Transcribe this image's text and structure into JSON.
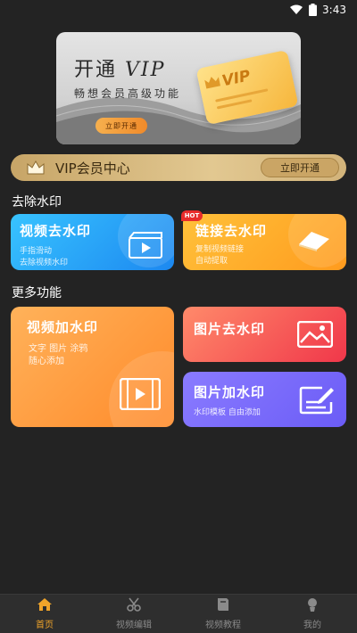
{
  "status_bar": {
    "time": "3:43"
  },
  "banner": {
    "title_cn": "开通",
    "title_en": "VIP",
    "subtitle": "畅想会员高级功能",
    "button": "立即开通",
    "card_label": "VIP"
  },
  "vip_center": {
    "label": "VIP会员中心",
    "button": "立即开通"
  },
  "sections": {
    "remove_watermark": "去除水印",
    "more_functions": "更多功能"
  },
  "cards": {
    "video_remove": {
      "title": "视频去水印",
      "line1": "手指滑动",
      "line2": "去除视频水印"
    },
    "link_remove": {
      "title": "链接去水印",
      "badge": "HOT",
      "line1": "复制视频链接",
      "line2": "自动提取"
    },
    "video_add": {
      "title": "视频加水印",
      "line1": "文字 图片 涂鸦",
      "line2": "随心添加"
    },
    "image_remove": {
      "title": "图片去水印"
    },
    "image_add": {
      "title": "图片加水印",
      "line1": "水印模板  自由添加"
    }
  },
  "nav": [
    {
      "label": "首页",
      "icon": "home-icon",
      "active": true
    },
    {
      "label": "视频编辑",
      "icon": "scissors-icon",
      "active": false
    },
    {
      "label": "视频教程",
      "icon": "book-icon",
      "active": false
    },
    {
      "label": "我的",
      "icon": "user-icon",
      "active": false
    }
  ],
  "colors": {
    "accent": "#f0a42a",
    "background": "#232323",
    "vip_gold": "#d8bb80"
  }
}
